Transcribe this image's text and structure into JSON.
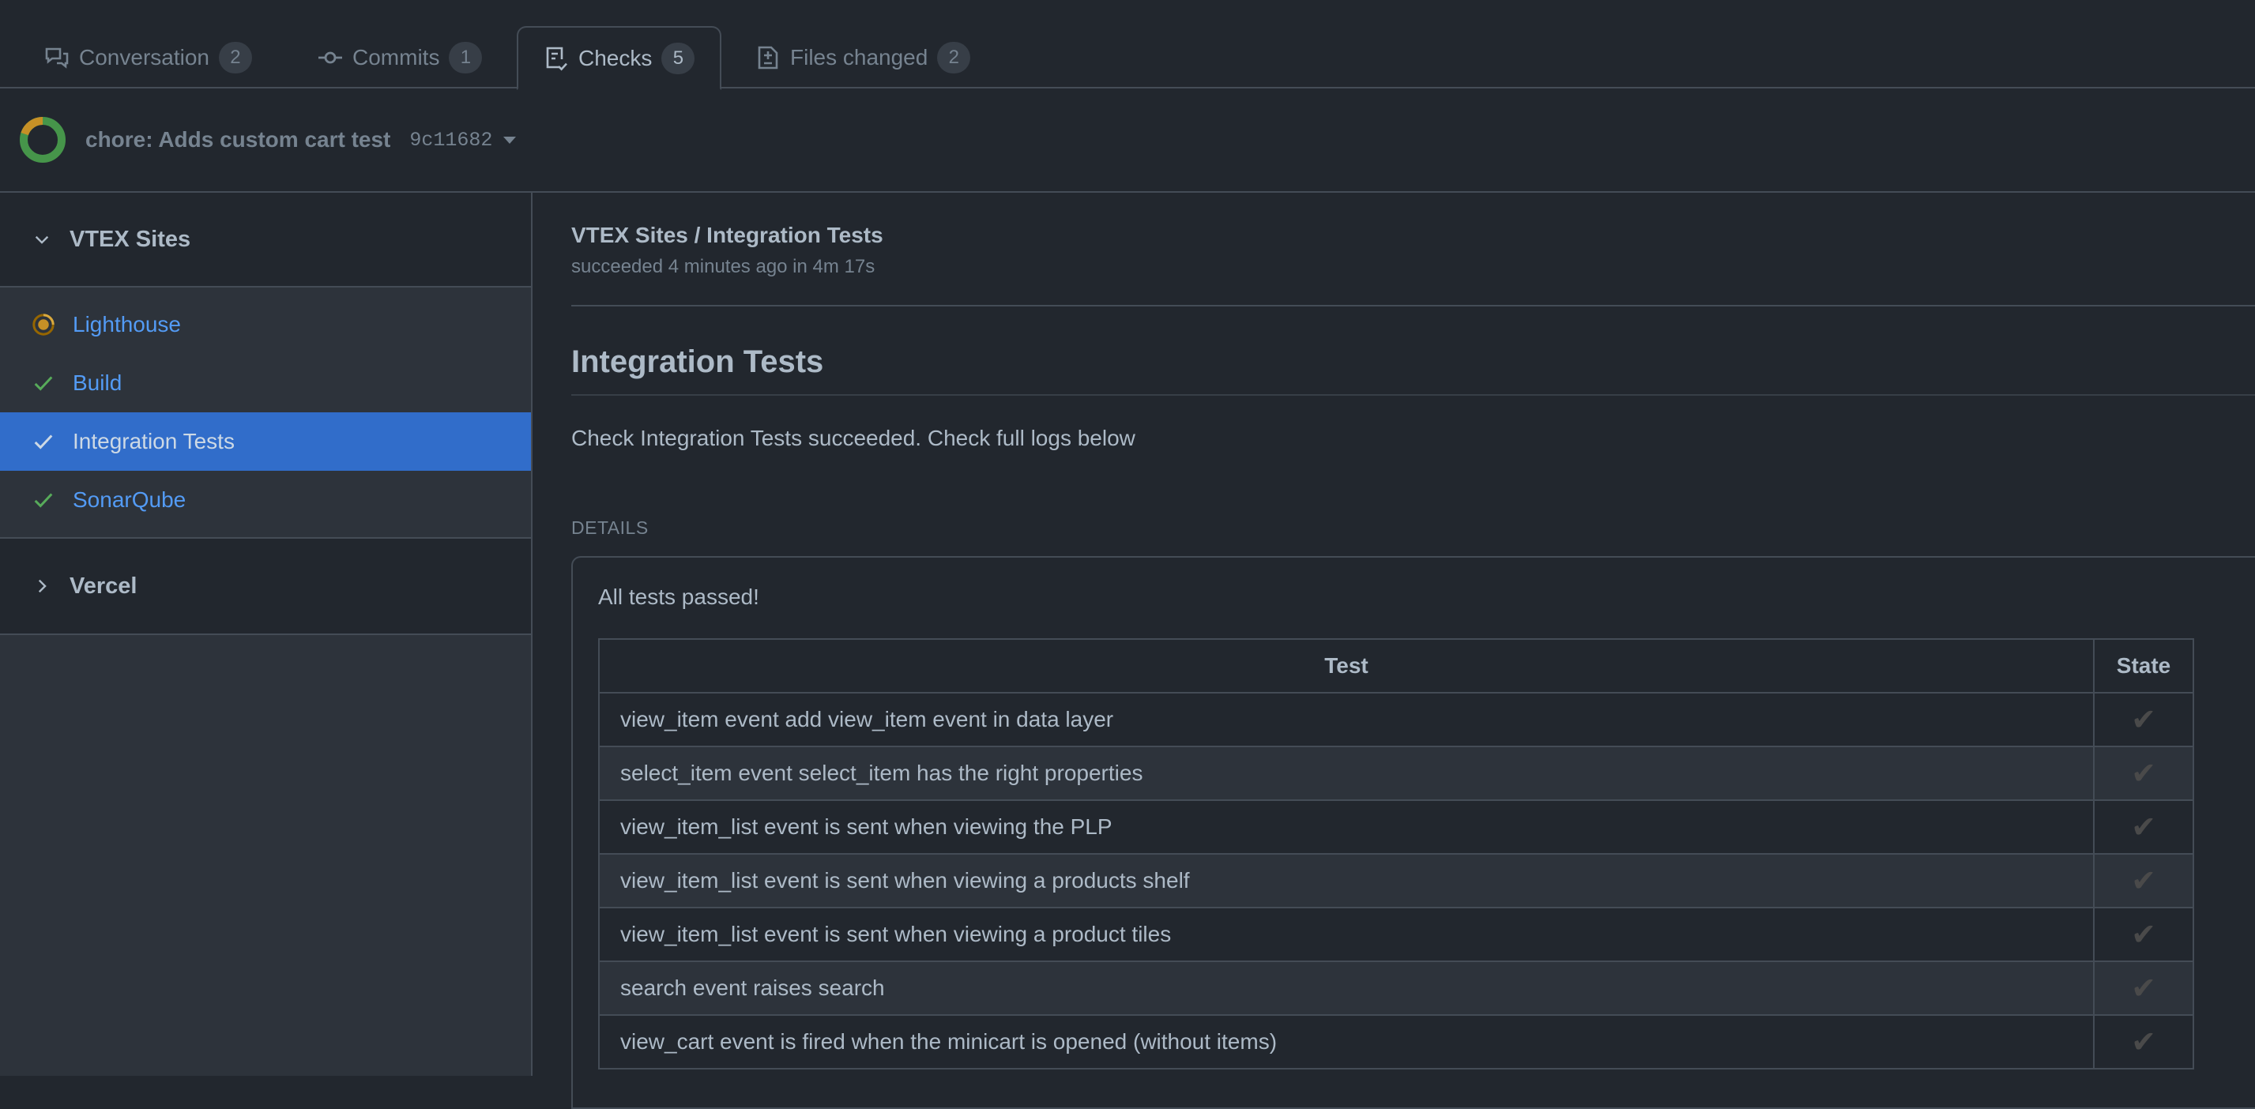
{
  "tabs": [
    {
      "label": "Conversation",
      "count": "2",
      "icon": "comment-discussion-icon",
      "active": false
    },
    {
      "label": "Commits",
      "count": "1",
      "icon": "git-commit-icon",
      "active": false
    },
    {
      "label": "Checks",
      "count": "5",
      "icon": "checklist-icon",
      "active": true
    },
    {
      "label": "Files changed",
      "count": "2",
      "icon": "file-diff-icon",
      "active": false
    }
  ],
  "commit": {
    "title": "chore: Adds custom cart test",
    "sha": "9c11682",
    "status_ring": {
      "success_fraction": 0.8,
      "pending_fraction": 0.2,
      "success_color": "#46954a",
      "pending_color": "#c69026"
    }
  },
  "sidebar": {
    "groups": [
      {
        "name": "VTEX Sites",
        "expanded": true,
        "checks": [
          {
            "label": "Lighthouse",
            "status": "in_progress",
            "selected": false
          },
          {
            "label": "Build",
            "status": "success",
            "selected": false
          },
          {
            "label": "Integration Tests",
            "status": "success",
            "selected": true
          },
          {
            "label": "SonarQube",
            "status": "success",
            "selected": false
          }
        ]
      },
      {
        "name": "Vercel",
        "expanded": false,
        "checks": []
      }
    ]
  },
  "run": {
    "title": "VTEX Sites / Integration Tests",
    "subtitle": "succeeded 4 minutes ago in 4m 17s",
    "section_title": "Integration Tests",
    "summary": "Check Integration Tests succeeded. Check full logs below",
    "details_label": "DETAILS",
    "details_heading": "All tests passed!",
    "table": {
      "headers": [
        "Test",
        "State"
      ],
      "rows": [
        {
          "test": "view_item event add view_item event in data layer",
          "state": "✔"
        },
        {
          "test": "select_item event select_item has the right properties",
          "state": "✔"
        },
        {
          "test": "view_item_list event is sent when viewing the PLP",
          "state": "✔"
        },
        {
          "test": "view_item_list event is sent when viewing a products shelf",
          "state": "✔"
        },
        {
          "test": "view_item_list event is sent when viewing a product tiles",
          "state": "✔"
        },
        {
          "test": "search event raises search",
          "state": "✔"
        },
        {
          "test": "view_cart event is fired when the minicart is opened (without items)",
          "state": "✔"
        }
      ]
    }
  },
  "colors": {
    "accent": "#316dca",
    "link": "#539bf5",
    "success": "#57ab5a",
    "pending": "#c69026",
    "background": "#22272e"
  }
}
